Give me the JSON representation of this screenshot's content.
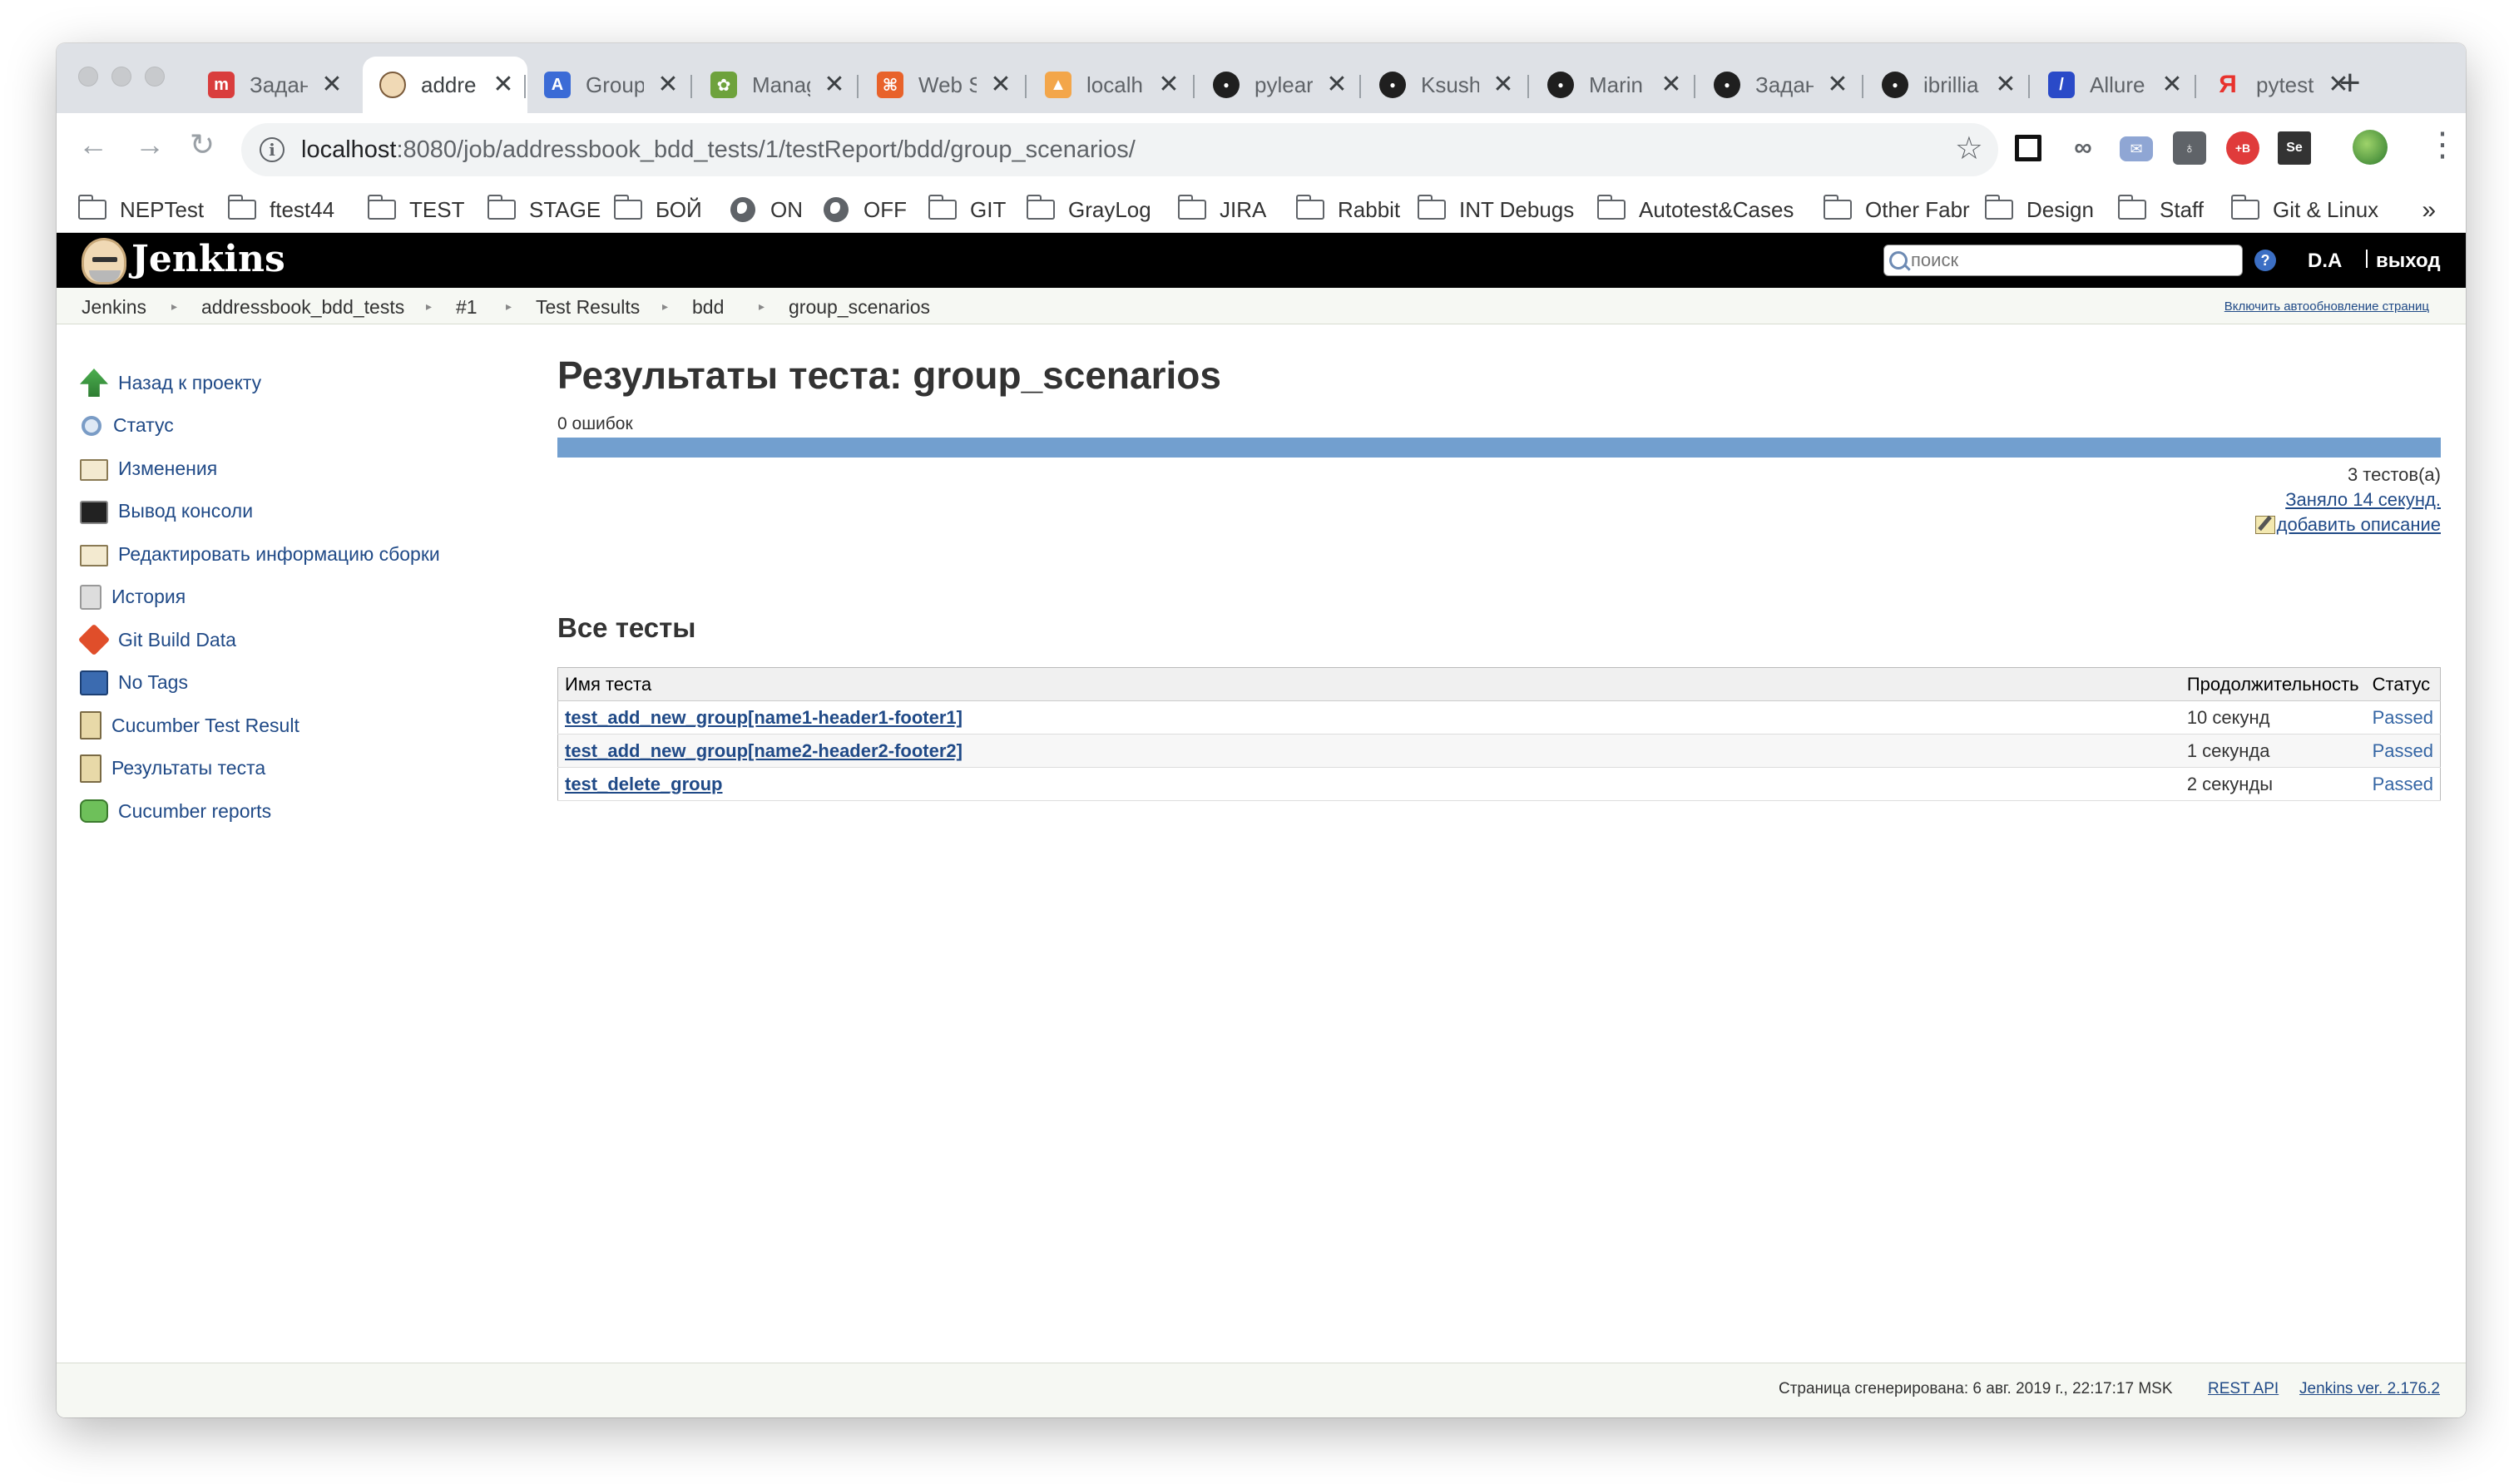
{
  "browser": {
    "tabs": [
      {
        "title": "Задан",
        "favicon": "red-square",
        "color": "#d93d3d"
      },
      {
        "title": "addre",
        "favicon": "jenkins",
        "color": "#f0d9b5",
        "active": true
      },
      {
        "title": "Group",
        "favicon": "a-letter",
        "color": "#3b6bd6"
      },
      {
        "title": "Manag",
        "favicon": "frog",
        "color": "#6ea23c"
      },
      {
        "title": "Web S",
        "favicon": "orange-box",
        "color": "#e8622a"
      },
      {
        "title": "localh",
        "favicon": "pma",
        "color": "#f3a64a"
      },
      {
        "title": "pylear",
        "favicon": "github",
        "color": "#1f1f1f"
      },
      {
        "title": "Ksush",
        "favicon": "github",
        "color": "#1f1f1f"
      },
      {
        "title": "Marin",
        "favicon": "github",
        "color": "#1f1f1f"
      },
      {
        "title": "Задан",
        "favicon": "github",
        "color": "#1f1f1f"
      },
      {
        "title": "ibrillia",
        "favicon": "github",
        "color": "#1f1f1f"
      },
      {
        "title": "Allure",
        "favicon": "allure",
        "color": "#2a4ac8"
      },
      {
        "title": "pytest",
        "favicon": "yandex",
        "color": "#e8322d"
      }
    ],
    "tab_close_glyph": "✕",
    "new_tab_glyph": "+",
    "url_host": "localhost",
    "url_path": ":8080/job/addressbook_bdd_tests/1/testReport/bdd/group_scenarios/",
    "bookmarks": [
      {
        "label": "NEPTest",
        "icon": "folder-icon"
      },
      {
        "label": "ftest44",
        "icon": "folder-icon"
      },
      {
        "label": "TEST",
        "icon": "folder-icon"
      },
      {
        "label": "STAGE",
        "icon": "folder-icon"
      },
      {
        "label": "БОЙ",
        "icon": "folder-icon"
      },
      {
        "label": "ON",
        "icon": "globe-icon"
      },
      {
        "label": "OFF",
        "icon": "globe-icon"
      },
      {
        "label": "GIT",
        "icon": "folder-icon"
      },
      {
        "label": "GrayLog",
        "icon": "folder-icon"
      },
      {
        "label": "JIRA",
        "icon": "folder-icon"
      },
      {
        "label": "Rabbit",
        "icon": "folder-icon"
      },
      {
        "label": "INT Debugs",
        "icon": "folder-icon"
      },
      {
        "label": "Autotest&Cases",
        "icon": "folder-icon"
      },
      {
        "label": "Other Fabr",
        "icon": "folder-icon"
      },
      {
        "label": "Design",
        "icon": "folder-icon"
      },
      {
        "label": "Staff",
        "icon": "folder-icon"
      },
      {
        "label": "Git & Linux",
        "icon": "folder-icon"
      }
    ],
    "bookmarks_more": "»"
  },
  "jenkins": {
    "title": "Jenkins",
    "search_placeholder": "поиск",
    "help": "?",
    "user": "D.A",
    "logout": "выход",
    "breadcrumbs": [
      "Jenkins",
      "addressbook_bdd_tests",
      "#1",
      "Test Results",
      "bdd",
      "group_scenarios"
    ],
    "autorefresh": "Включить автообновление страниц",
    "side": [
      {
        "label": "Назад к проекту",
        "icon": "up-arrow-icon"
      },
      {
        "label": "Статус",
        "icon": "magnifier-icon"
      },
      {
        "label": "Изменения",
        "icon": "notepad-icon"
      },
      {
        "label": "Вывод консоли",
        "icon": "terminal-icon"
      },
      {
        "label": "Редактировать информацию сборки",
        "icon": "notepad-edit-icon"
      },
      {
        "label": "История",
        "icon": "history-icon"
      },
      {
        "label": "Git Build Data",
        "icon": "git-icon"
      },
      {
        "label": "No Tags",
        "icon": "save-icon"
      },
      {
        "label": "Cucumber Test Result",
        "icon": "clipboard-icon"
      },
      {
        "label": "Результаты теста",
        "icon": "clipboard-icon"
      },
      {
        "label": "Cucumber reports",
        "icon": "speech-bubble-icon"
      }
    ],
    "main": {
      "title": "Результаты теста: group_scenarios",
      "failures": "0 ошибок",
      "pass_fraction": 1.0,
      "test_count": "3 тестов(а)",
      "duration": "Заняло 14 секунд.",
      "add_description": "добавить описание",
      "all_tests_heading": "Все тесты",
      "columns": [
        "Имя теста",
        "Продолжительность",
        "Статус"
      ],
      "rows": [
        {
          "name": "test_add_new_group[name1-header1-footer1]",
          "duration": "10 секунд",
          "status": "Passed"
        },
        {
          "name": "test_add_new_group[name2-header2-footer2]",
          "duration": "1 секунда",
          "status": "Passed"
        },
        {
          "name": "test_delete_group",
          "duration": "2 секунды",
          "status": "Passed"
        }
      ]
    },
    "footer": {
      "generated": "Страница сгенерирована: 6 авг. 2019 г., 22:17:17 MSK",
      "rest_api": "REST API",
      "version": "Jenkins ver. 2.176.2"
    }
  },
  "colors": {
    "link": "#204a87",
    "pass_bar": "#729fcf",
    "header_bg": "#000000"
  }
}
